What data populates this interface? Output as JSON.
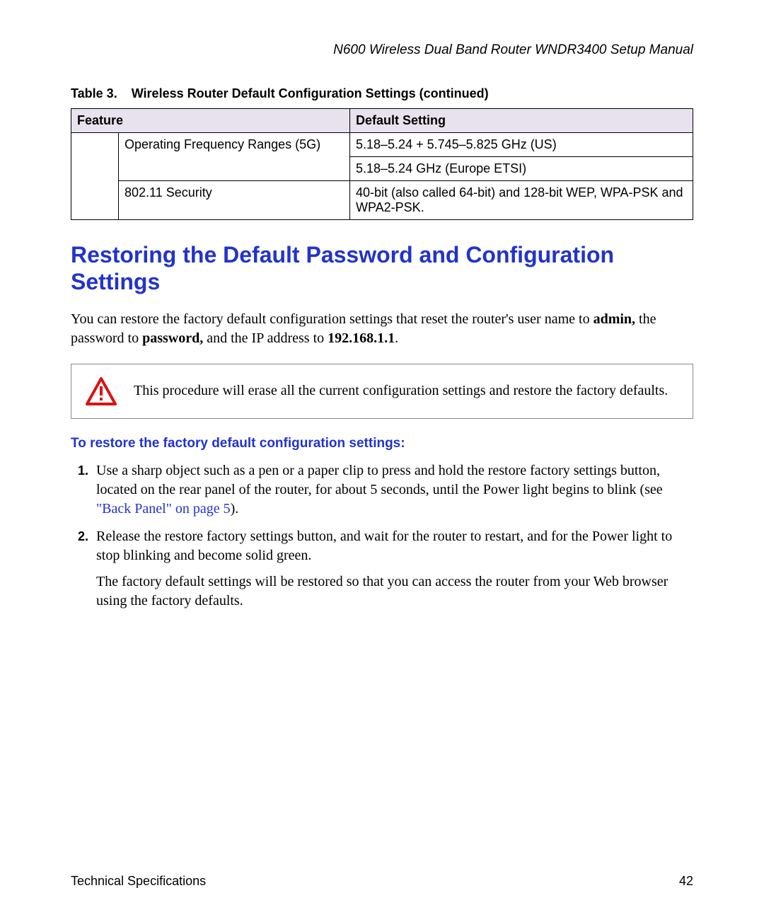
{
  "running_head": "N600 Wireless Dual Band Router WNDR3400 Setup Manual",
  "table": {
    "caption_prefix": "Table 3.",
    "caption": "Wireless Router Default Configuration Settings (continued)",
    "headers": {
      "feature": "Feature",
      "default": "Default Setting"
    },
    "rows": [
      {
        "feature": "Operating Frequency Ranges (5G)",
        "values": [
          "5.18–5.24 + 5.745–5.825 GHz (US)",
          "5.18–5.24 GHz (Europe ETSI)"
        ]
      },
      {
        "feature": "802.11 Security",
        "values": [
          "40-bit (also called 64-bit) and 128-bit WEP, WPA-PSK and WPA2-PSK."
        ]
      }
    ]
  },
  "section_title": "Restoring the Default Password and Configuration Settings",
  "intro": {
    "pre": "You can restore the factory default configuration settings that reset the router's user name to ",
    "admin": "admin,",
    "mid1": " the password to ",
    "password": "password,",
    "mid2": " and the IP address to ",
    "ip": "192.168.1.1",
    "end": "."
  },
  "callout": "This procedure will erase all the current configuration settings and restore the factory defaults.",
  "subhead": "To restore the factory default configuration settings:",
  "steps": {
    "s1_pre": "Use a sharp object such as a pen or a paper clip to press and hold the restore factory settings button, located on the rear panel of the router, for about 5 seconds, until the Power light begins to blink (see ",
    "s1_link": "\"Back Panel\" on page 5",
    "s1_post": ").",
    "s2_a": "Release the restore factory settings button, and wait for the router to restart, and for the Power light to stop blinking and become solid green.",
    "s2_b": "The factory default settings will be restored so that you can access the router from your Web browser using the factory defaults."
  },
  "footer": {
    "left": "Technical Specifications",
    "right": "42"
  }
}
